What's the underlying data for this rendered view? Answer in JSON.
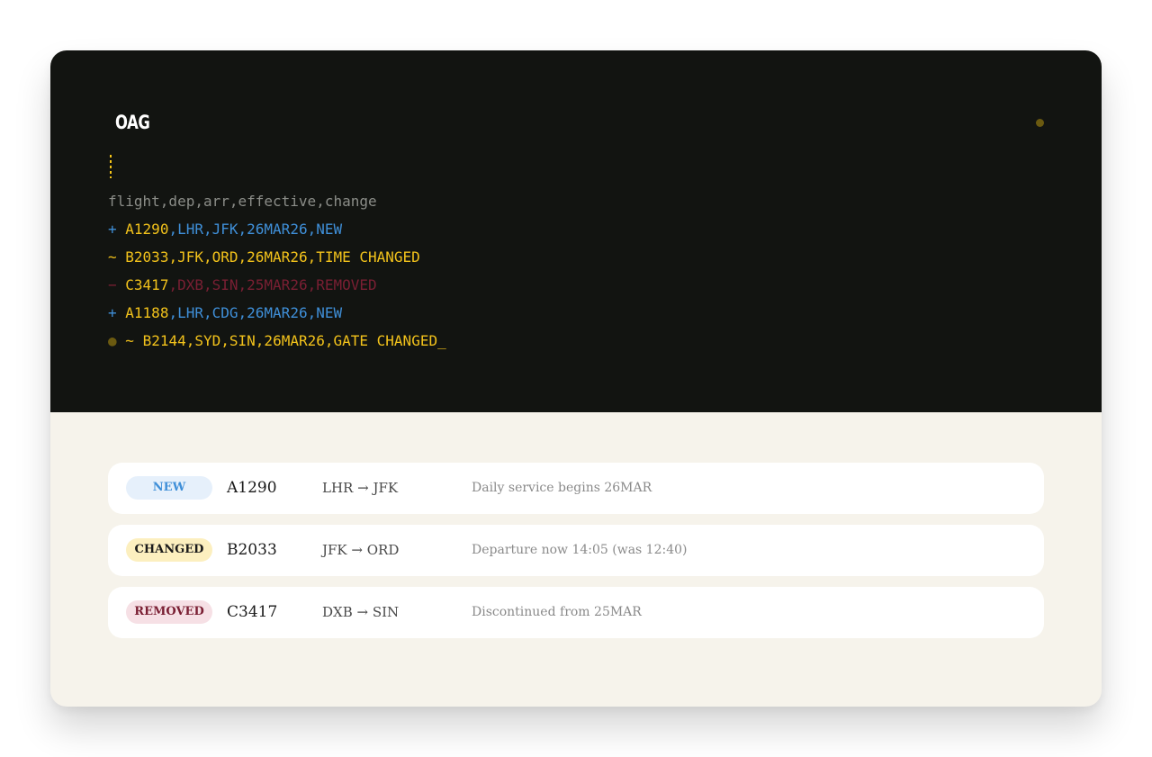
{
  "app": {
    "logo": "OAG"
  },
  "terminal": {
    "header": "flight,dep,arr,effective,change",
    "lines": [
      {
        "marker": "+",
        "flight": "A1290",
        "rest": ",LHR,JFK,26MAR26,NEW"
      },
      {
        "marker": "~",
        "flight": "B2033",
        "rest": ",JFK,ORD,26MAR26,TIME CHANGED"
      },
      {
        "marker": "−",
        "flight": "C3417",
        "rest": ",DXB,SIN,25MAR26,REMOVED"
      },
      {
        "marker": "+",
        "flight": "A1188",
        "rest": ",LHR,CDG,26MAR26,NEW"
      },
      {
        "marker": "~",
        "flight": "B2144",
        "rest": ",SYD,SIN,26MAR26,GATE CHANGED",
        "cursor": "_"
      }
    ]
  },
  "changes": [
    {
      "badge": "NEW",
      "flight": "A1290",
      "route": "LHR → JFK",
      "note": "Daily service begins 26MAR"
    },
    {
      "badge": "CHANGED",
      "flight": "B2033",
      "route": "JFK → ORD",
      "note": "Departure now 14:05 (was 12:40)"
    },
    {
      "badge": "REMOVED",
      "flight": "C3417",
      "route": "DXB → SIN",
      "note": "Discontinued from 25MAR"
    }
  ],
  "colors": {
    "terminal_bg": "#121411",
    "panel_bg": "#f6f3eb",
    "new": "#3f8fd8",
    "changed": "#f2c21b",
    "removed": "#7a1f33"
  }
}
